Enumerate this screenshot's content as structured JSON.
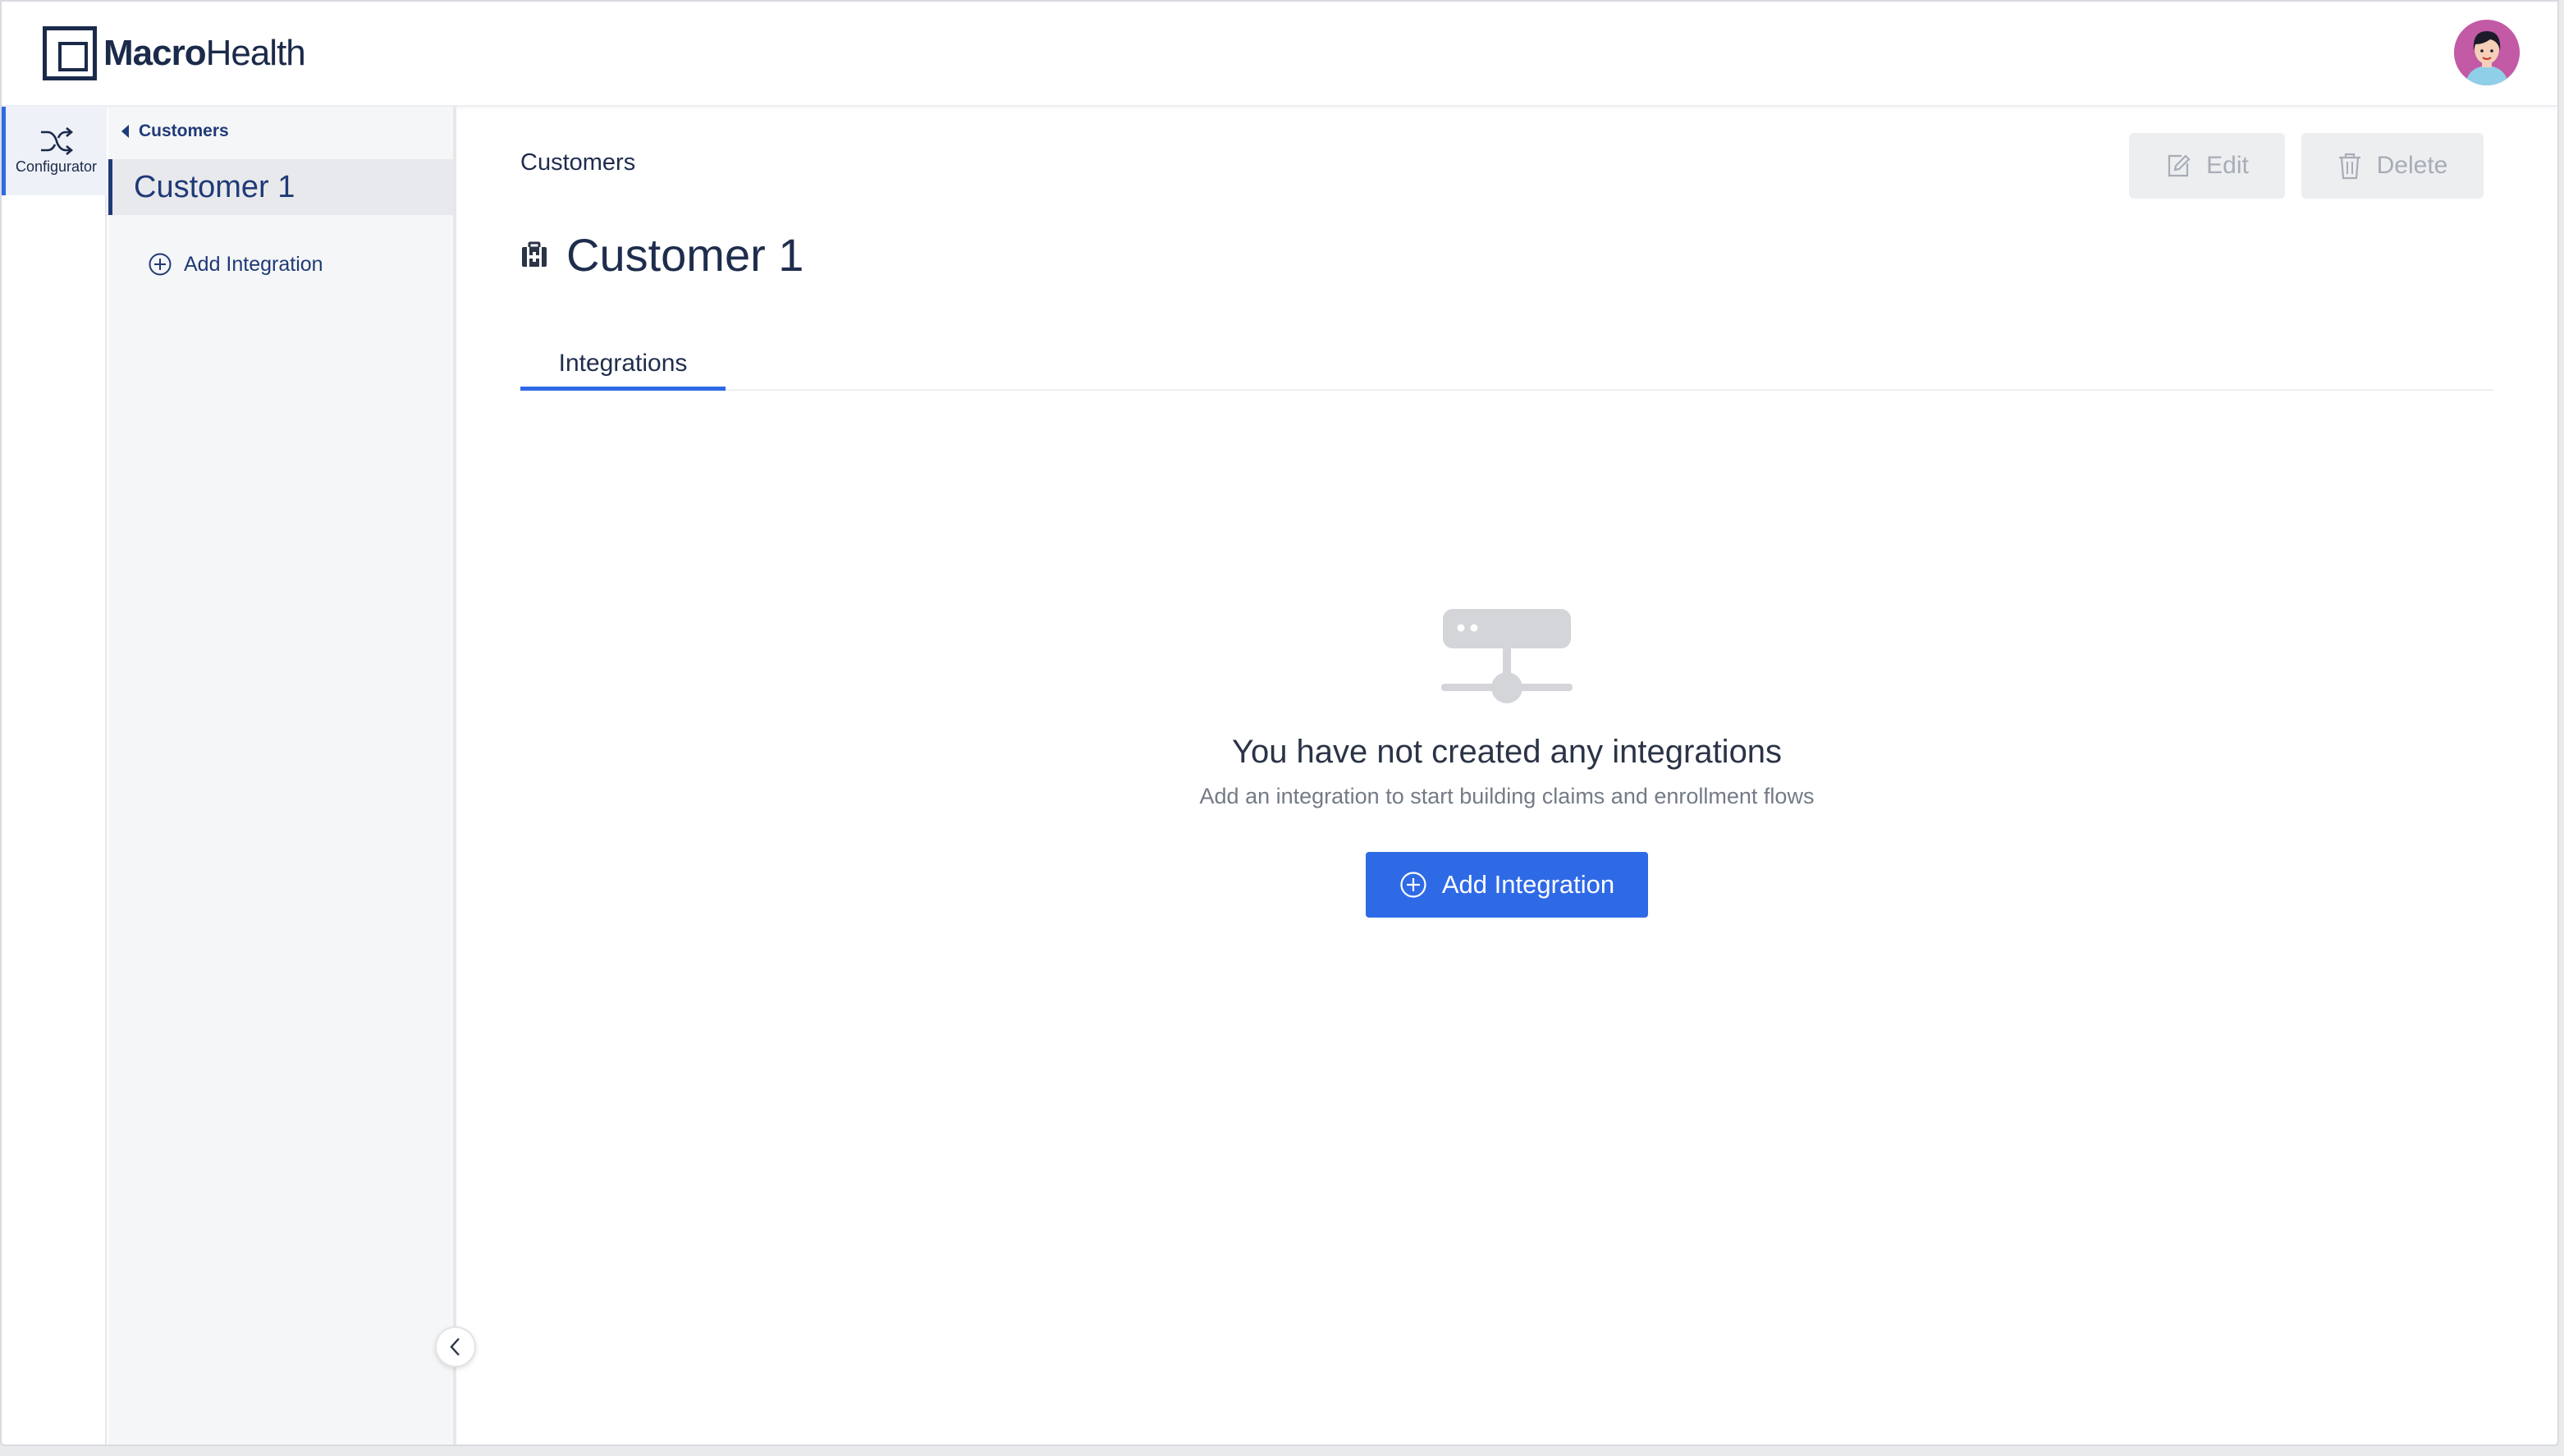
{
  "brand": {
    "name_bold": "Macro",
    "name_light": "Health"
  },
  "rail": {
    "configurator_label": "Configurator",
    "icon": "shuffle-icon"
  },
  "sidebar": {
    "back_label": "Customers",
    "current_label": "Customer 1",
    "add_label": "Add Integration"
  },
  "main": {
    "breadcrumb": "Customers",
    "title": "Customer 1",
    "title_icon": "medical-briefcase-icon",
    "actions": {
      "edit_label": "Edit",
      "delete_label": "Delete"
    },
    "tabs": [
      {
        "label": "Integrations",
        "active": true
      }
    ],
    "empty_state": {
      "heading": "You have not created any integrations",
      "subtext": "Add an integration to start building claims and enrollment flows",
      "button_label": "Add Integration",
      "illustration": "server-network-icon"
    }
  },
  "colors": {
    "primary": "#2f6ae6",
    "navy": "#1f3a78",
    "sidebar_bg": "#f5f6f7",
    "disabled_text": "#a7adb6"
  }
}
